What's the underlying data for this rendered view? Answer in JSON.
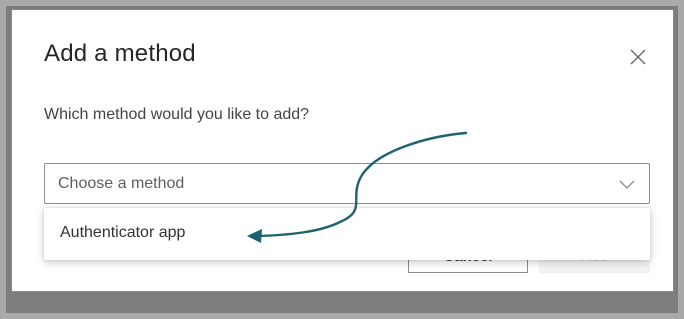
{
  "dialog": {
    "title": "Add a method",
    "question": "Which method would you like to add?",
    "select": {
      "placeholder": "Choose a method",
      "options": [
        "Authenticator app"
      ]
    },
    "buttons": {
      "cancel": "Cancel",
      "add": "Add"
    },
    "icons": {
      "close": "close-icon",
      "dropdown": "chevron-down-icon",
      "annotation": "curved-arrow-icon"
    }
  },
  "colors": {
    "arrow": "#1e6170",
    "title": "#262626",
    "border": "#8d8d8d"
  }
}
